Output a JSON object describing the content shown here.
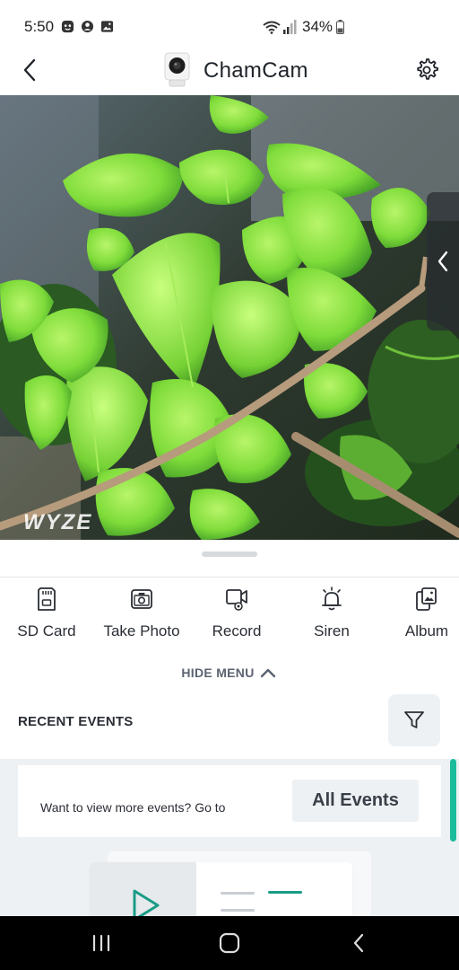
{
  "status_bar": {
    "time": "5:50",
    "battery": "34%",
    "left_icons": [
      "bitmoji-icon",
      "account-icon",
      "image-icon"
    ],
    "right_icons": [
      "wifi-icon",
      "signal-icon",
      "battery-icon"
    ]
  },
  "header": {
    "title": "ChamCam"
  },
  "live_view": {
    "watermark": "WYZE"
  },
  "controls": [
    {
      "label": "SD Card",
      "icon": "sd-card-icon"
    },
    {
      "label": "Take Photo",
      "icon": "camera-icon"
    },
    {
      "label": "Record",
      "icon": "record-icon"
    },
    {
      "label": "Siren",
      "icon": "siren-icon"
    },
    {
      "label": "Album",
      "icon": "album-icon"
    }
  ],
  "menu": {
    "hide_label": "HIDE MENU"
  },
  "recent_events": {
    "title": "RECENT EVENTS"
  },
  "more_events": {
    "text": "Want to view more events? Go to",
    "button": "All Events"
  },
  "colors": {
    "accent": "#1abc9c",
    "text": "#2a2e34",
    "muted": "#5b6470",
    "background": "#eef1f4"
  }
}
